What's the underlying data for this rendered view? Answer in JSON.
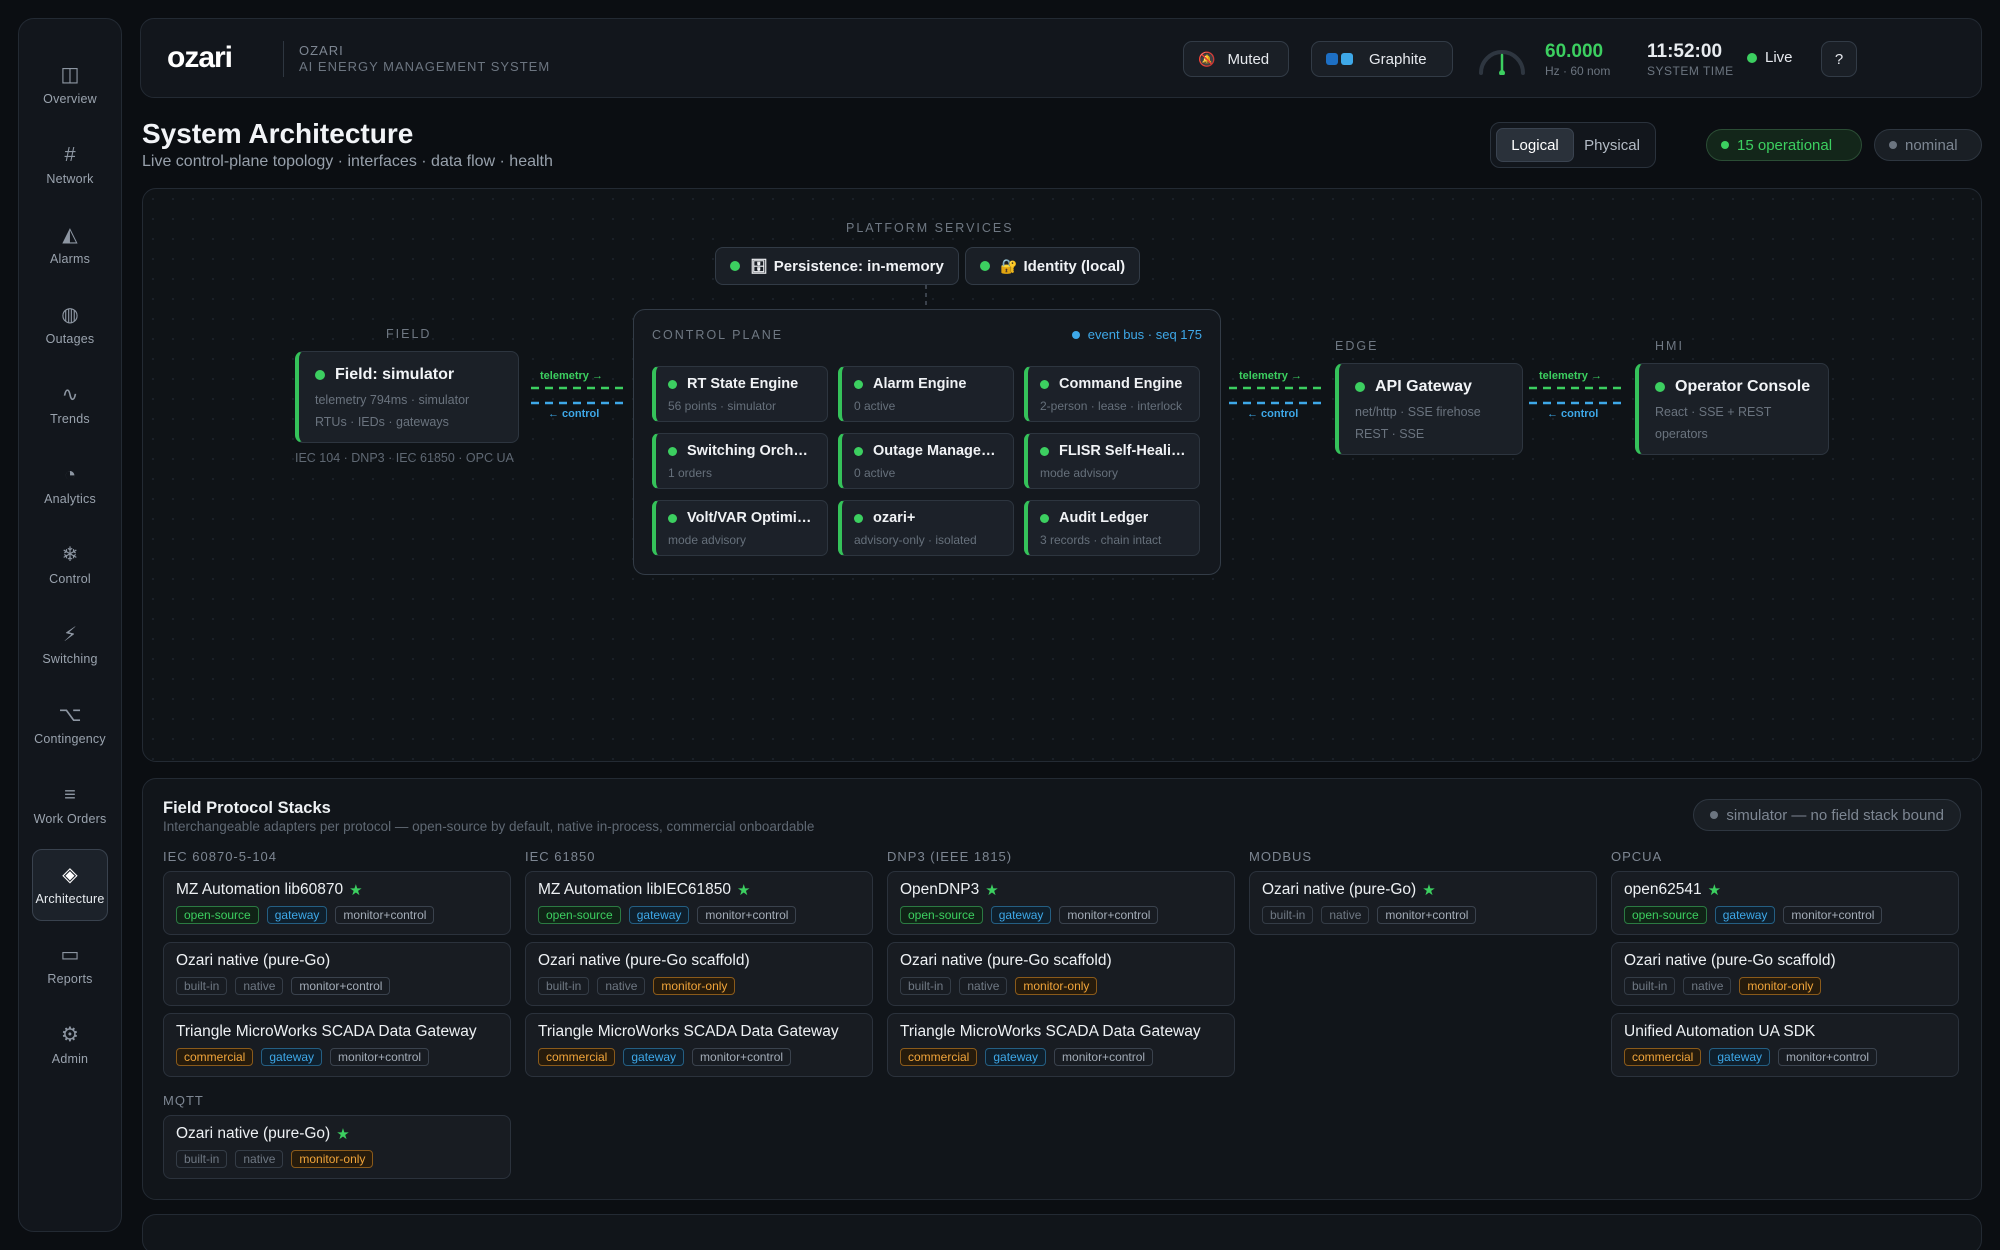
{
  "sidebar": {
    "items": [
      {
        "label": "Overview",
        "icon": "◫"
      },
      {
        "label": "Network",
        "icon": "#"
      },
      {
        "label": "Alarms",
        "icon": "◭"
      },
      {
        "label": "Outages",
        "icon": "◍"
      },
      {
        "label": "Trends",
        "icon": "∿"
      },
      {
        "label": "Analytics",
        "icon": "◔"
      },
      {
        "label": "Control",
        "icon": "❄"
      },
      {
        "label": "Switching",
        "icon": "⚡"
      },
      {
        "label": "Contingency",
        "icon": "⌥"
      },
      {
        "label": "Work Orders",
        "icon": "≡"
      },
      {
        "label": "Architecture",
        "icon": "◈"
      },
      {
        "label": "Reports",
        "icon": "▭"
      },
      {
        "label": "Admin",
        "icon": "⚙"
      }
    ],
    "active": "Architecture"
  },
  "header": {
    "logo": "ozari",
    "brand_title": "OZARI",
    "brand_sub": "AI ENERGY MANAGEMENT SYSTEM",
    "muted_label": "Muted",
    "muted_icon": "🔕",
    "theme_label": "Graphite",
    "theme_colors": [
      "#1d6fc4",
      "#3ea8e8"
    ],
    "freq_value": "60.000",
    "freq_sub": "Hz · 60 nom",
    "time_value": "11:52:00",
    "time_sub": "SYSTEM TIME",
    "live_label": "Live",
    "help_label": "?"
  },
  "page": {
    "title": "System Architecture",
    "subtitle": "Live control-plane topology · interfaces · data flow · health",
    "view_options": [
      "Logical",
      "Physical"
    ],
    "operational_label": "15 operational",
    "nominal_label": "nominal"
  },
  "architecture": {
    "platform_label": "PLATFORM SERVICES",
    "platform_services": [
      {
        "icon": "🗄",
        "label": "Persistence: in-memory"
      },
      {
        "icon": "🔐",
        "label": "Identity (local)"
      }
    ],
    "field": {
      "label": "FIELD",
      "title": "Field: simulator",
      "line1": "telemetry 794ms · simulator",
      "line2": "RTUs · IEDs · gateways",
      "protocols": "IEC 104 · DNP3 · IEC 61850 · OPC UA"
    },
    "control_plane": {
      "label": "CONTROL PLANE",
      "bus": "event bus · seq 175",
      "cards": [
        {
          "title": "RT State Engine",
          "sub": "56 points · simulator"
        },
        {
          "title": "Alarm Engine",
          "sub": "0 active"
        },
        {
          "title": "Command Engine",
          "sub": "2-person · lease · interlock"
        },
        {
          "title": "Switching Orchestrator",
          "sub": "1 orders"
        },
        {
          "title": "Outage Management",
          "sub": "0 active"
        },
        {
          "title": "FLISR Self-Healing",
          "sub": "mode advisory"
        },
        {
          "title": "Volt/VAR Optimization",
          "sub": "mode advisory"
        },
        {
          "title": "ozari+",
          "sub": "advisory-only · isolated"
        },
        {
          "title": "Audit Ledger",
          "sub": "3 records · chain intact"
        }
      ]
    },
    "edge": {
      "label": "EDGE",
      "title": "API Gateway",
      "line1": "net/http · SSE firehose",
      "line2": "REST · SSE"
    },
    "hmi": {
      "label": "HMI",
      "title": "Operator Console",
      "line1": "React · SSE + REST",
      "line2": "operators"
    },
    "link_telemetry": "telemetry →",
    "link_control": "← control"
  },
  "stacks": {
    "title": "Field Protocol Stacks",
    "subtitle": "Interchangeable adapters per protocol — open-source by default, native in-process, commercial onboardable",
    "badge": "simulator — no field stack bound",
    "columns": [
      {
        "name": "IEC 60870-5-104",
        "items": [
          {
            "name": "MZ Automation lib60870",
            "star": true,
            "tags": [
              [
                "open-source",
                "green"
              ],
              [
                "gateway",
                "blue"
              ],
              [
                "monitor+control",
                "plain"
              ]
            ]
          },
          {
            "name": "Ozari native (pure-Go)",
            "star": false,
            "tags": [
              [
                "built-in",
                "grey"
              ],
              [
                "native",
                "grey"
              ],
              [
                "monitor+control",
                "plain"
              ]
            ]
          },
          {
            "name": "Triangle MicroWorks SCADA Data Gateway",
            "star": false,
            "tags": [
              [
                "commercial",
                "orange"
              ],
              [
                "gateway",
                "blue"
              ],
              [
                "monitor+control",
                "plain"
              ]
            ]
          }
        ]
      },
      {
        "name": "IEC 61850",
        "items": [
          {
            "name": "MZ Automation libIEC61850",
            "star": true,
            "tags": [
              [
                "open-source",
                "green"
              ],
              [
                "gateway",
                "blue"
              ],
              [
                "monitor+control",
                "plain"
              ]
            ]
          },
          {
            "name": "Ozari native (pure-Go scaffold)",
            "star": false,
            "tags": [
              [
                "built-in",
                "grey"
              ],
              [
                "native",
                "grey"
              ],
              [
                "monitor-only",
                "orange"
              ]
            ]
          },
          {
            "name": "Triangle MicroWorks SCADA Data Gateway",
            "star": false,
            "tags": [
              [
                "commercial",
                "orange"
              ],
              [
                "gateway",
                "blue"
              ],
              [
                "monitor+control",
                "plain"
              ]
            ]
          }
        ]
      },
      {
        "name": "DNP3 (IEEE 1815)",
        "items": [
          {
            "name": "OpenDNP3",
            "star": true,
            "tags": [
              [
                "open-source",
                "green"
              ],
              [
                "gateway",
                "blue"
              ],
              [
                "monitor+control",
                "plain"
              ]
            ]
          },
          {
            "name": "Ozari native (pure-Go scaffold)",
            "star": false,
            "tags": [
              [
                "built-in",
                "grey"
              ],
              [
                "native",
                "grey"
              ],
              [
                "monitor-only",
                "orange"
              ]
            ]
          },
          {
            "name": "Triangle MicroWorks SCADA Data Gateway",
            "star": false,
            "tags": [
              [
                "commercial",
                "orange"
              ],
              [
                "gateway",
                "blue"
              ],
              [
                "monitor+control",
                "plain"
              ]
            ]
          }
        ]
      },
      {
        "name": "MODBUS",
        "items": [
          {
            "name": "Ozari native (pure-Go)",
            "star": true,
            "tags": [
              [
                "built-in",
                "grey"
              ],
              [
                "native",
                "grey"
              ],
              [
                "monitor+control",
                "plain"
              ]
            ]
          }
        ]
      },
      {
        "name": "OPCUA",
        "items": [
          {
            "name": "open62541",
            "star": true,
            "tags": [
              [
                "open-source",
                "green"
              ],
              [
                "gateway",
                "blue"
              ],
              [
                "monitor+control",
                "plain"
              ]
            ]
          },
          {
            "name": "Ozari native (pure-Go scaffold)",
            "star": false,
            "tags": [
              [
                "built-in",
                "grey"
              ],
              [
                "native",
                "grey"
              ],
              [
                "monitor-only",
                "orange"
              ]
            ]
          },
          {
            "name": "Unified Automation UA SDK",
            "star": false,
            "tags": [
              [
                "commercial",
                "orange"
              ],
              [
                "gateway",
                "blue"
              ],
              [
                "monitor+control",
                "plain"
              ]
            ]
          }
        ]
      },
      {
        "name": "MQTT",
        "items": [
          {
            "name": "Ozari native (pure-Go)",
            "star": true,
            "tags": [
              [
                "built-in",
                "grey"
              ],
              [
                "native",
                "grey"
              ],
              [
                "monitor-only",
                "orange"
              ]
            ]
          }
        ]
      }
    ]
  },
  "colors": {
    "accent_green": "#3ccf60",
    "accent_blue": "#3ea8e8",
    "warning_orange": "#f0a43a"
  }
}
